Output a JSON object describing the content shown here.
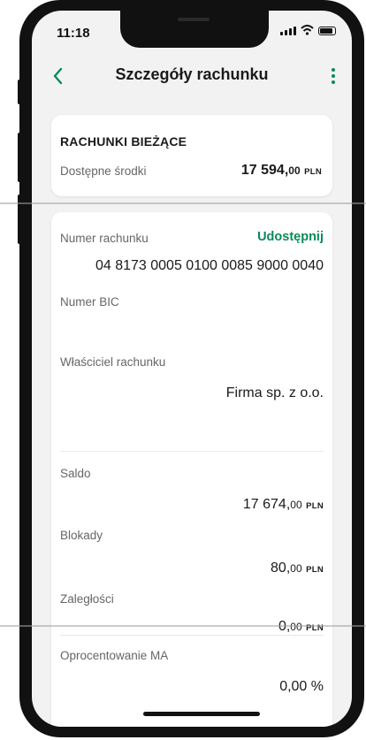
{
  "status_bar": {
    "time": "11:18"
  },
  "nav": {
    "title": "Szczegóły rachunku"
  },
  "summary": {
    "type": "RACHUNKI BIEŻĄCE",
    "available_label": "Dostępne środki",
    "available_int": "17 594,",
    "available_dec": "00",
    "available_cur": "PLN"
  },
  "details": {
    "account_number_label": "Numer rachunku",
    "share_label": "Udostępnij",
    "account_number": "04 8173 0005 0100 0085 9000 0040",
    "bic_label": "Numer BIC",
    "owner_label": "Właściciel rachunku",
    "owner_value": "Firma sp. z o.o.",
    "saldo_label": "Saldo",
    "saldo_int": "17 674,",
    "saldo_dec": "00",
    "saldo_cur": "PLN",
    "blokady_label": "Blokady",
    "blokady_int": "80,",
    "blokady_dec": "00",
    "blokady_cur": "PLN",
    "zaleglosci_label": "Zaległości",
    "zaleglosci_int": "0,",
    "zaleglosci_dec": "00",
    "zaleglosci_cur": "PLN",
    "oprocentowanie_label": "Oprocentowanie MA",
    "oprocentowanie_value": "0,00 %"
  },
  "colors": {
    "accent": "#0a8a5a",
    "background": "#f2f2f2"
  }
}
